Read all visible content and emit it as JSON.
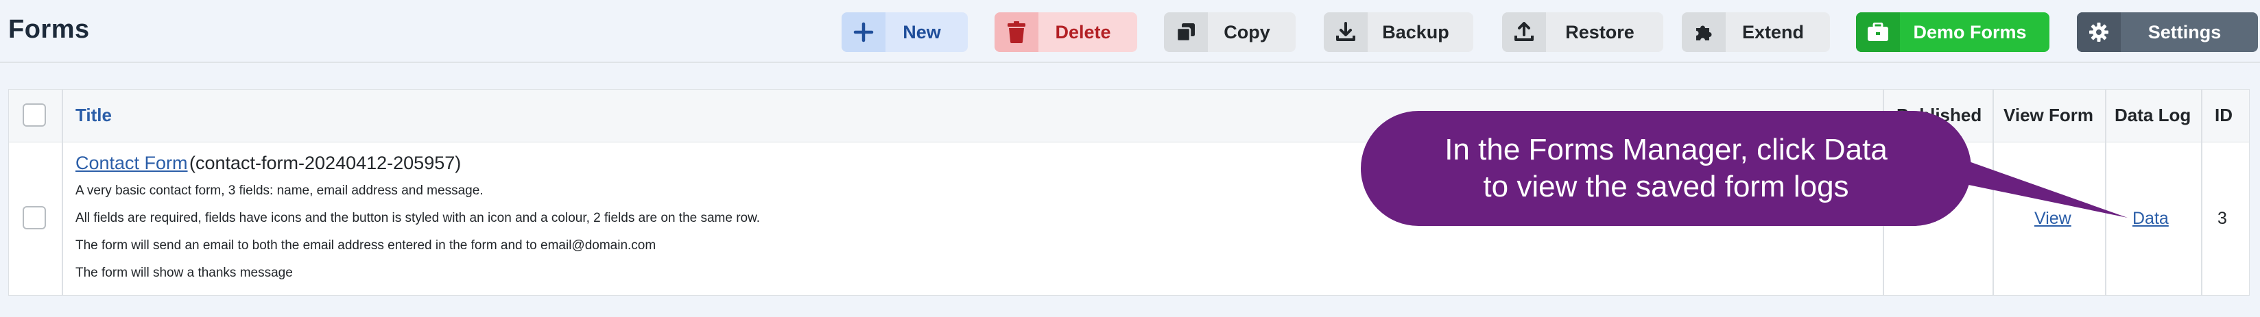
{
  "header": {
    "title": "Forms",
    "toolbar": {
      "new": "New",
      "delete": "Delete",
      "copy": "Copy",
      "backup": "Backup",
      "restore": "Restore",
      "extend": "Extend",
      "demo_forms": "Demo Forms",
      "settings": "Settings"
    }
  },
  "table": {
    "columns": {
      "title": "Title",
      "published": "Published",
      "view_form": "View Form",
      "data_log": "Data Log",
      "id": "ID"
    },
    "rows": [
      {
        "title": "Contact Form",
        "alias": "(contact-form-20240412-205957)",
        "description": [
          "A very basic contact form, 3 fields: name, email address and message.",
          "All fields are required, fields have icons and the button is styled with an icon and a colour, 2 fields are on the same row.",
          "The form will send an email to both the email address entered in the form and to email@domain.com",
          "The form will show a thanks message"
        ],
        "view": "View",
        "data": "Data",
        "id": "3"
      }
    ]
  },
  "callout": {
    "line1": "In the Forms Manager, click Data",
    "line2": "to view the saved form logs"
  },
  "colors": {
    "accent_blue": "#2b5ea8",
    "new_bg": "#dbe7fb",
    "delete_bg": "#fad7d9",
    "delete_text": "#b32025",
    "demo_green": "#25c03a",
    "settings_gray": "#5c6a79",
    "callout_purple": "#6a207f"
  },
  "icons": {
    "new": "plus-icon",
    "delete": "trash-icon",
    "copy": "copy-icon",
    "backup": "download-icon",
    "restore": "upload-icon",
    "extend": "puzzle-icon",
    "demo_forms": "briefcase-icon",
    "settings": "gear-icon"
  }
}
